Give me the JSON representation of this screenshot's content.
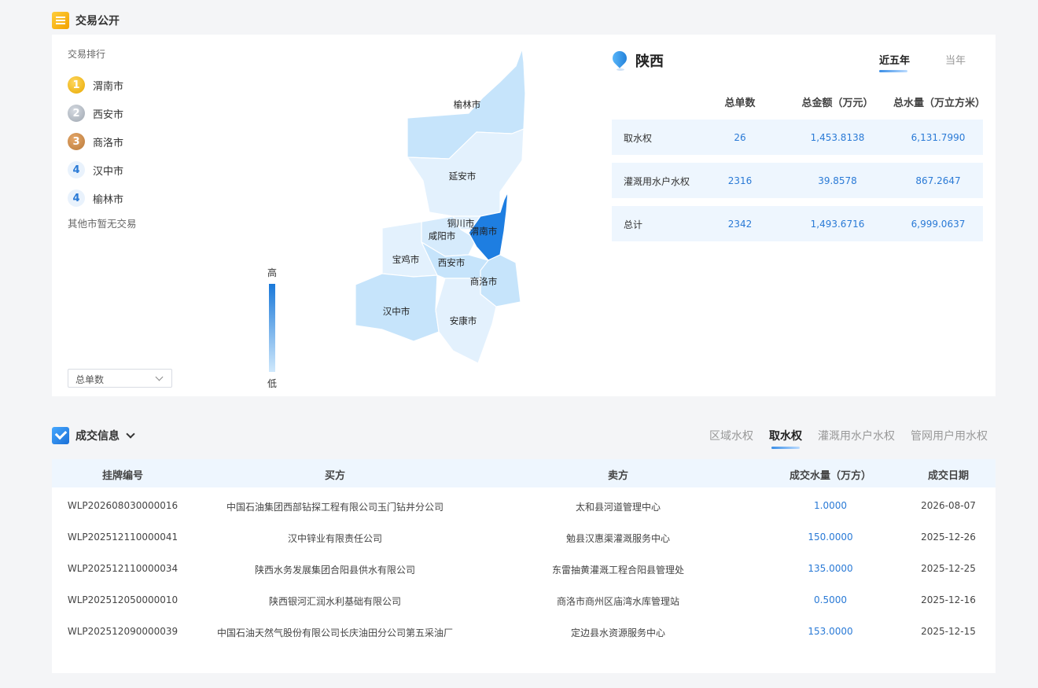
{
  "public_section": {
    "title": "交易公开"
  },
  "ranking": {
    "title": "交易排行",
    "items": [
      {
        "rank": "1",
        "name": "渭南市"
      },
      {
        "rank": "2",
        "name": "西安市"
      },
      {
        "rank": "3",
        "name": "商洛市"
      },
      {
        "rank": "4",
        "name": "汉中市"
      },
      {
        "rank": "4",
        "name": "榆林市"
      }
    ],
    "other_note": "其他市暂无交易"
  },
  "metric_select": {
    "value": "总单数"
  },
  "legend": {
    "high": "高",
    "low": "低"
  },
  "map": {
    "cities": [
      "榆林市",
      "延安市",
      "铜川市",
      "咸阳市",
      "渭南市",
      "宝鸡市",
      "西安市",
      "商洛市",
      "汉中市",
      "安康市"
    ]
  },
  "province": {
    "name": "陕西",
    "tabs": [
      "近五年",
      "当年"
    ],
    "active_tab": "近五年",
    "columns": [
      "总单数",
      "总金额（万元）",
      "总水量（万立方米）"
    ],
    "rows": [
      {
        "label": "取水权",
        "count": "26",
        "amount": "1,453.8138",
        "volume": "6,131.7990"
      },
      {
        "label": "灌溉用水户水权",
        "count": "2316",
        "amount": "39.8578",
        "volume": "867.2647"
      },
      {
        "label": "总计",
        "count": "2342",
        "amount": "1,493.6716",
        "volume": "6,999.0637"
      }
    ]
  },
  "deal_section": {
    "title": "成交信息",
    "tabs": [
      "区域水权",
      "取水权",
      "灌溉用水户水权",
      "管网用户用水权"
    ],
    "active_tab": "取水权",
    "columns": [
      "挂牌编号",
      "买方",
      "卖方",
      "成交水量（万方）",
      "成交日期"
    ],
    "rows": [
      {
        "id": "WLP202608030000016",
        "buyer": "中国石油集团西部钻探工程有限公司玉门钻井分公司",
        "seller": "太和县河道管理中心",
        "volume": "1.0000",
        "date": "2026-08-07"
      },
      {
        "id": "WLP202512110000041",
        "buyer": "汉中锌业有限责任公司",
        "seller": "勉县汉惠渠灌溉服务中心",
        "volume": "150.0000",
        "date": "2025-12-26"
      },
      {
        "id": "WLP202512110000034",
        "buyer": "陕西水务发展集团合阳县供水有限公司",
        "seller": "东雷抽黄灌溉工程合阳县管理处",
        "volume": "135.0000",
        "date": "2025-12-25"
      },
      {
        "id": "WLP202512050000010",
        "buyer": "陕西银河汇润水利基础有限公司",
        "seller": "商洛市商州区庙湾水库管理站",
        "volume": "0.5000",
        "date": "2025-12-16"
      },
      {
        "id": "WLP202512090000039",
        "buyer": "中国石油天然气股份有限公司长庆油田分公司第五采油厂",
        "seller": "定边县水资源服务中心",
        "volume": "153.0000",
        "date": "2025-12-15"
      }
    ]
  },
  "colors": {
    "accent": "#2a7ad6",
    "map_high": "#1a78d9",
    "map_low": "#e8f4fe"
  }
}
